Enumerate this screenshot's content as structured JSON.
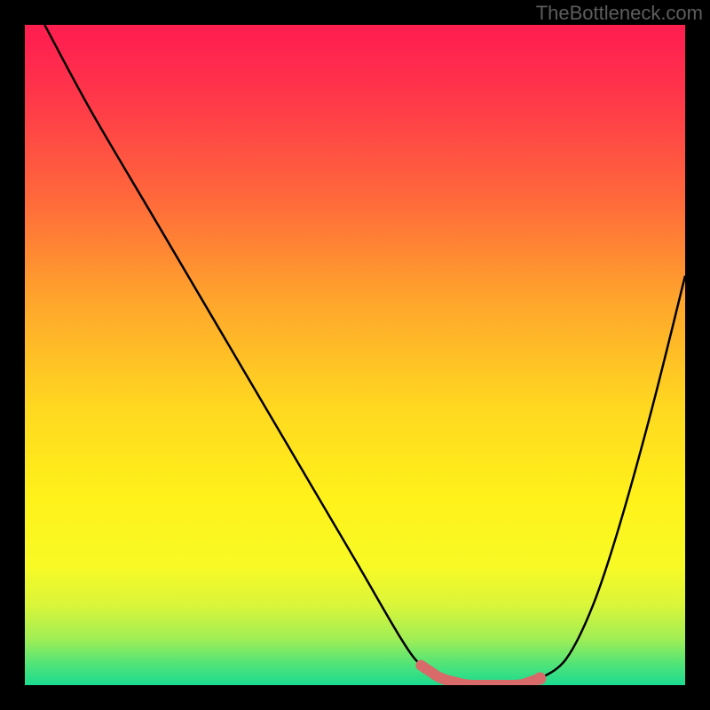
{
  "watermark": "TheBottleneck.com",
  "chart_data": {
    "type": "line",
    "title": "",
    "xlabel": "",
    "ylabel": "",
    "xlim": [
      0,
      100
    ],
    "ylim": [
      0,
      100
    ],
    "grid": false,
    "legend": false,
    "background": "rainbow-gradient-red-to-green",
    "series": [
      {
        "name": "bottleneck-curve",
        "color": "#000000",
        "x": [
          3,
          10,
          20,
          30,
          40,
          50,
          57,
          60,
          63,
          67,
          71,
          75,
          78,
          82,
          86,
          90,
          95,
          100
        ],
        "y": [
          100,
          87,
          70,
          53,
          36,
          19,
          7,
          3,
          1,
          0,
          0,
          0,
          1,
          4,
          12,
          24,
          42,
          62
        ]
      }
    ],
    "highlight": {
      "name": "optimal-range",
      "color": "#d86a6a",
      "x_start": 60,
      "x_end": 78,
      "dot_x": 78
    }
  }
}
